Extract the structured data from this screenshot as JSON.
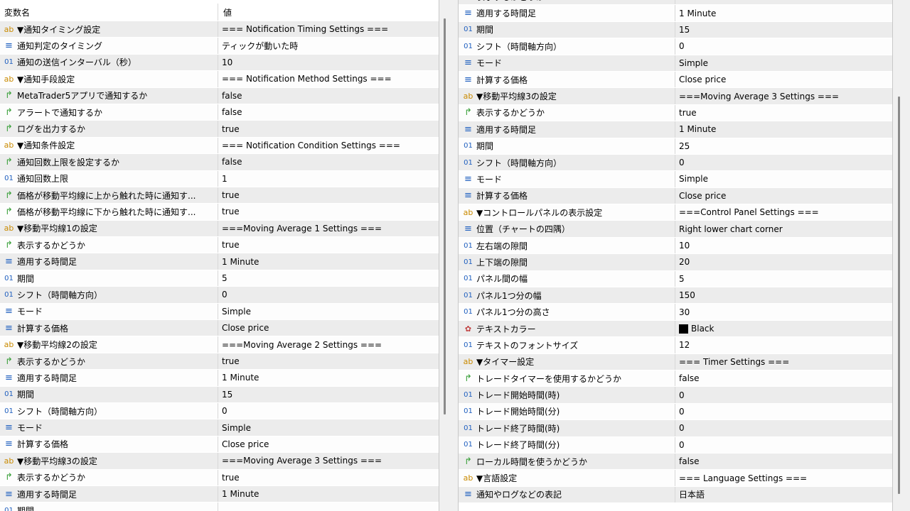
{
  "header": {
    "name_col": "変数名",
    "value_col": "値"
  },
  "left_rows": [
    {
      "icon": "ab",
      "name": "▼通知タイミング設定",
      "value": "=== Notification Timing Settings ==="
    },
    {
      "icon": "enum",
      "name": "通知判定のタイミング",
      "value": "ティックが動いた時"
    },
    {
      "icon": "num",
      "name": "通知の送信インターバル（秒）",
      "value": "10"
    },
    {
      "icon": "ab",
      "name": "▼通知手段設定",
      "value": "=== Notification Method Settings ==="
    },
    {
      "icon": "bool",
      "name": "MetaTrader5アプリで通知するか",
      "value": "false"
    },
    {
      "icon": "bool",
      "name": "アラートで通知するか",
      "value": "false"
    },
    {
      "icon": "bool",
      "name": "ログを出力するか",
      "value": "true"
    },
    {
      "icon": "ab",
      "name": "▼通知条件設定",
      "value": "=== Notification Condition Settings ==="
    },
    {
      "icon": "bool",
      "name": "通知回数上限を設定するか",
      "value": "false"
    },
    {
      "icon": "num",
      "name": "通知回数上限",
      "value": "1"
    },
    {
      "icon": "bool",
      "name": "価格が移動平均線に上から触れた時に通知す...",
      "value": "true"
    },
    {
      "icon": "bool",
      "name": "価格が移動平均線に下から触れた時に通知す...",
      "value": "true"
    },
    {
      "icon": "ab",
      "name": "▼移動平均線1の設定",
      "value": "===Moving Average 1 Settings ==="
    },
    {
      "icon": "bool",
      "name": "表示するかどうか",
      "value": "true"
    },
    {
      "icon": "enum",
      "name": "適用する時間足",
      "value": "1 Minute"
    },
    {
      "icon": "num",
      "name": "期間",
      "value": "5"
    },
    {
      "icon": "num",
      "name": "シフト（時間軸方向）",
      "value": "0"
    },
    {
      "icon": "enum",
      "name": "モード",
      "value": "Simple"
    },
    {
      "icon": "enum",
      "name": "計算する価格",
      "value": "Close price"
    },
    {
      "icon": "ab",
      "name": "▼移動平均線2の設定",
      "value": "===Moving Average 2 Settings ==="
    },
    {
      "icon": "bool",
      "name": "表示するかどうか",
      "value": "true"
    },
    {
      "icon": "enum",
      "name": "適用する時間足",
      "value": "1 Minute"
    },
    {
      "icon": "num",
      "name": "期間",
      "value": "15"
    },
    {
      "icon": "num",
      "name": "シフト（時間軸方向）",
      "value": "0"
    },
    {
      "icon": "enum",
      "name": "モード",
      "value": "Simple"
    },
    {
      "icon": "enum",
      "name": "計算する価格",
      "value": "Close price"
    },
    {
      "icon": "ab",
      "name": "▼移動平均線3の設定",
      "value": "===Moving Average 3 Settings ==="
    },
    {
      "icon": "bool",
      "name": "表示するかどうか",
      "value": "true"
    },
    {
      "icon": "enum",
      "name": "適用する時間足",
      "value": "1 Minute"
    },
    {
      "icon": "num",
      "name": "期間",
      "value": ""
    }
  ],
  "right_rows": [
    {
      "icon": "bool",
      "name": "表示するかどうか",
      "value": "true"
    },
    {
      "icon": "enum",
      "name": "適用する時間足",
      "value": "1 Minute"
    },
    {
      "icon": "num",
      "name": "期間",
      "value": "15"
    },
    {
      "icon": "num",
      "name": "シフト（時間軸方向）",
      "value": "0"
    },
    {
      "icon": "enum",
      "name": "モード",
      "value": "Simple"
    },
    {
      "icon": "enum",
      "name": "計算する価格",
      "value": "Close price"
    },
    {
      "icon": "ab",
      "name": "▼移動平均線3の設定",
      "value": "===Moving Average 3 Settings ==="
    },
    {
      "icon": "bool",
      "name": "表示するかどうか",
      "value": "true"
    },
    {
      "icon": "enum",
      "name": "適用する時間足",
      "value": "1 Minute"
    },
    {
      "icon": "num",
      "name": "期間",
      "value": "25"
    },
    {
      "icon": "num",
      "name": "シフト（時間軸方向）",
      "value": "0"
    },
    {
      "icon": "enum",
      "name": "モード",
      "value": "Simple"
    },
    {
      "icon": "enum",
      "name": "計算する価格",
      "value": "Close price"
    },
    {
      "icon": "ab",
      "name": "▼コントロールパネルの表示設定",
      "value": "===Control Panel Settings ==="
    },
    {
      "icon": "enum",
      "name": "位置（チャートの四隅）",
      "value": "Right lower chart corner"
    },
    {
      "icon": "num",
      "name": "左右端の隙間",
      "value": "10"
    },
    {
      "icon": "num",
      "name": "上下端の隙間",
      "value": "20"
    },
    {
      "icon": "num",
      "name": "パネル間の幅",
      "value": "5"
    },
    {
      "icon": "num",
      "name": "パネル1つ分の幅",
      "value": "150"
    },
    {
      "icon": "num",
      "name": "パネル1つ分の高さ",
      "value": "30"
    },
    {
      "icon": "color",
      "name": "テキストカラー",
      "value": "Black",
      "swatch": "#000000"
    },
    {
      "icon": "num",
      "name": "テキストのフォントサイズ",
      "value": "12"
    },
    {
      "icon": "ab",
      "name": "▼タイマー設定",
      "value": "=== Timer Settings ==="
    },
    {
      "icon": "bool",
      "name": "トレードタイマーを使用するかどうか",
      "value": "false"
    },
    {
      "icon": "num",
      "name": "トレード開始時間(時)",
      "value": "0"
    },
    {
      "icon": "num",
      "name": "トレード開始時間(分)",
      "value": "0"
    },
    {
      "icon": "num",
      "name": "トレード終了時間(時)",
      "value": "0"
    },
    {
      "icon": "num",
      "name": "トレード終了時間(分)",
      "value": "0"
    },
    {
      "icon": "bool",
      "name": "ローカル時間を使うかどうか",
      "value": "false"
    },
    {
      "icon": "ab",
      "name": "▼言語設定",
      "value": "=== Language Settings ==="
    },
    {
      "icon": "enum",
      "name": "通知やログなどの表記",
      "value": "日本語"
    }
  ]
}
